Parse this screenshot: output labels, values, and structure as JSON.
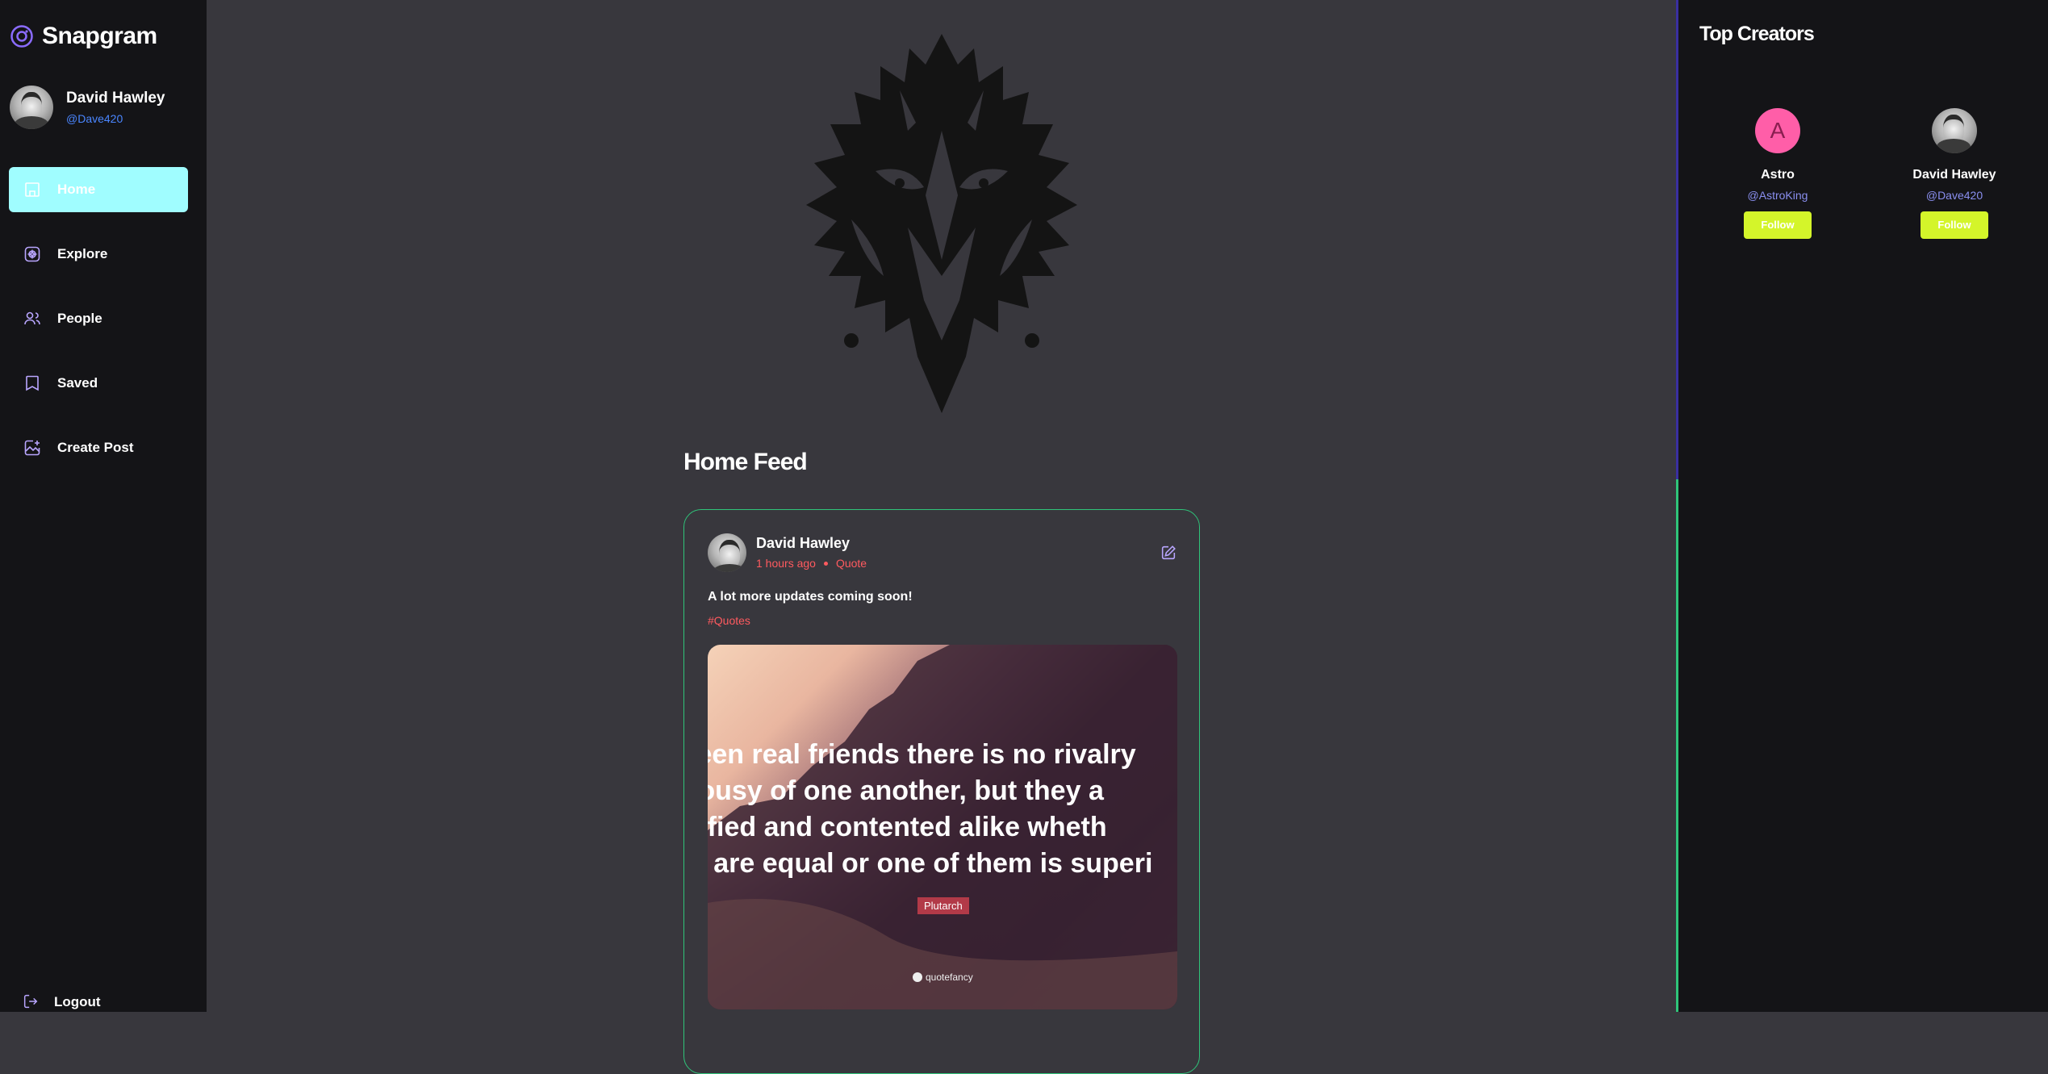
{
  "app": {
    "name": "Snapgram"
  },
  "user": {
    "name": "David Hawley",
    "handle": "@Dave420"
  },
  "nav": {
    "items": [
      {
        "label": "Home",
        "icon": "home-icon",
        "active": true
      },
      {
        "label": "Explore",
        "icon": "explore-icon",
        "active": false
      },
      {
        "label": "People",
        "icon": "people-icon",
        "active": false
      },
      {
        "label": "Saved",
        "icon": "bookmark-icon",
        "active": false
      },
      {
        "label": "Create Post",
        "icon": "create-post-icon",
        "active": false
      }
    ],
    "logout_label": "Logout"
  },
  "feed": {
    "title": "Home Feed",
    "posts": [
      {
        "author": "David Hawley",
        "time": "1 hours ago",
        "location": "Quote",
        "caption": "A lot more updates coming soon!",
        "tags": "#Quotes",
        "image": {
          "quote_lines": [
            "ween real friends there is no rivalry",
            "alousy of one another, but they a",
            "tisfied and contented alike wheth",
            "ey are equal or one of them is superi"
          ],
          "quote_author": "Plutarch",
          "brand": "quotefancy"
        }
      }
    ]
  },
  "top_creators": {
    "title": "Top Creators",
    "creators": [
      {
        "initial": "A",
        "name": "Astro",
        "handle": "@AstroKing",
        "follow_label": "Follow"
      },
      {
        "name": "David Hawley",
        "handle": "@Dave420",
        "follow_label": "Follow"
      }
    ]
  },
  "colors": {
    "accent_active": "#a0fdff",
    "handle_blue": "#4a86ff",
    "meta_red": "#ff5a5f",
    "follow_lime": "#d4f52a",
    "card_border": "#2fc47a",
    "creator_handle": "#8a8ff0",
    "astro_avatar": "#ff5ea8"
  }
}
